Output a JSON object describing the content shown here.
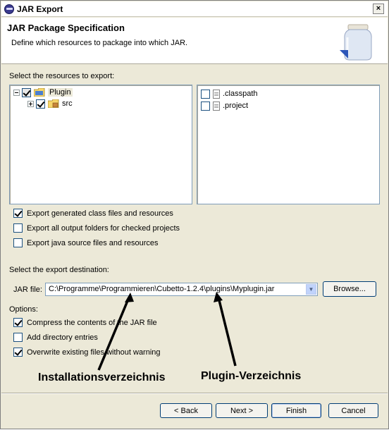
{
  "window": {
    "title": "JAR Export",
    "close_symbol": "×"
  },
  "header": {
    "title": "JAR Package Specification",
    "description": "Define which resources to package into which JAR."
  },
  "resources": {
    "label": "Select the resources to export:",
    "tree": [
      {
        "label": "Plugin",
        "checked": true,
        "expanded": true,
        "icon": "project-folder-icon"
      },
      {
        "label": "src",
        "checked": true,
        "expanded": false,
        "icon": "package-folder-icon"
      }
    ],
    "files": [
      {
        "label": ".classpath",
        "checked": false
      },
      {
        "label": ".project",
        "checked": false
      }
    ]
  },
  "export_options": [
    {
      "label": "Export generated class files and resources",
      "checked": true
    },
    {
      "label": "Export all output folders for checked projects",
      "checked": false
    },
    {
      "label": "Export java source files and resources",
      "checked": false
    }
  ],
  "destination": {
    "label": "Select the export destination:",
    "jar_label": "JAR file:",
    "jar_value": "C:\\Programme\\Programmieren\\Cubetto-1.2.4\\plugins\\Myplugin.jar",
    "browse_label": "Browse..."
  },
  "options": {
    "label": "Options:",
    "items": [
      {
        "label": "Compress the contents of the JAR file",
        "checked": true
      },
      {
        "label": "Add directory entries",
        "checked": false
      },
      {
        "label": "Overwrite existing files without warning",
        "checked": true
      }
    ]
  },
  "annotations": {
    "install": "Installationsverzeichnis",
    "plugin": "Plugin-Verzeichnis"
  },
  "buttons": {
    "back": "< Back",
    "next": "Next >",
    "finish": "Finish",
    "cancel": "Cancel"
  }
}
